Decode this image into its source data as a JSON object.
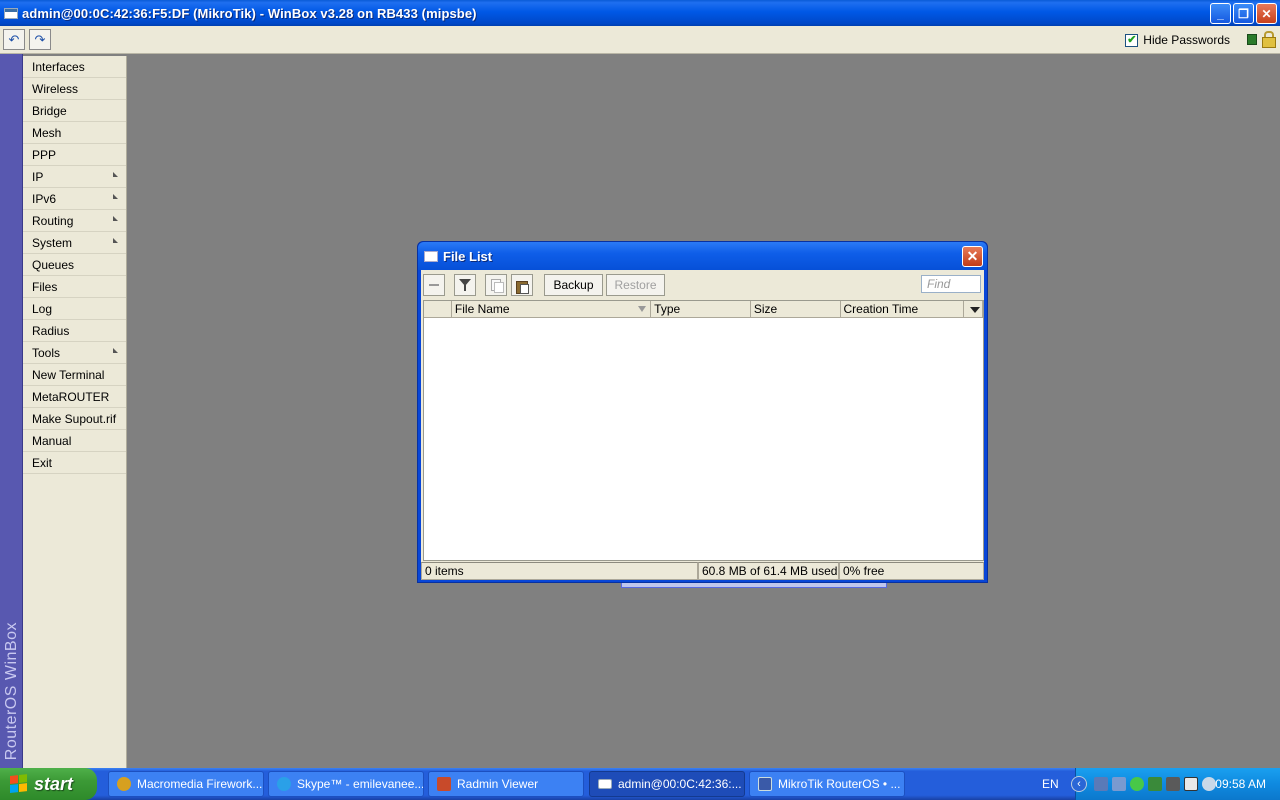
{
  "window": {
    "title": "admin@00:0C:42:36:F5:DF (MikroTik) - WinBox v3.28 on RB433 (mipsbe)",
    "minimize_label": "_",
    "restore_label": "❐",
    "close_label": "✕"
  },
  "toolbar": {
    "undo_label": "↶",
    "redo_label": "↷",
    "hide_passwords_label": "Hide Passwords",
    "hide_passwords_checked": "✔"
  },
  "brand": {
    "label": "RouterOS WinBox"
  },
  "menu": {
    "items": [
      {
        "label": "Interfaces"
      },
      {
        "label": "Wireless"
      },
      {
        "label": "Bridge"
      },
      {
        "label": "Mesh"
      },
      {
        "label": "PPP"
      },
      {
        "label": "IP"
      },
      {
        "label": "IPv6"
      },
      {
        "label": "Routing"
      },
      {
        "label": "System"
      },
      {
        "label": "Queues"
      },
      {
        "label": "Files"
      },
      {
        "label": "Log"
      },
      {
        "label": "Radius"
      },
      {
        "label": "Tools"
      },
      {
        "label": "New Terminal"
      },
      {
        "label": "MetaROUTER"
      },
      {
        "label": "Make Supout.rif"
      },
      {
        "label": "Manual"
      },
      {
        "label": "Exit"
      }
    ]
  },
  "file_list": {
    "title": "File List",
    "close_label": "✕",
    "backup_label": "Backup",
    "restore_label": "Restore",
    "find_placeholder": "Find",
    "columns": {
      "file_name": "File Name",
      "type": "Type",
      "size": "Size",
      "creation_time": "Creation Time"
    },
    "status": {
      "items": "0 items",
      "used": "60.8 MB of 61.4 MB used",
      "free": "0% free"
    }
  },
  "taskbar": {
    "start_label": "start",
    "tasks": [
      {
        "label": "Macromedia Firework...",
        "active": false
      },
      {
        "label": "Skype™ - emilevanee...",
        "active": false
      },
      {
        "label": "Radmin Viewer",
        "active": false
      },
      {
        "label": "admin@00:0C:42:36:...",
        "active": true
      },
      {
        "label": "MikroTik RouterOS • ...",
        "active": false
      }
    ],
    "language": "EN",
    "clock": "09:58 AM",
    "chevron_label": "‹"
  },
  "colors": {
    "title_bar": "#0058e6",
    "menu_bg": "#ece9d8",
    "desktop": "#808080",
    "brand_strip": "#5858b0",
    "taskbar": "#245edb",
    "start_button": "#3c9a36"
  }
}
